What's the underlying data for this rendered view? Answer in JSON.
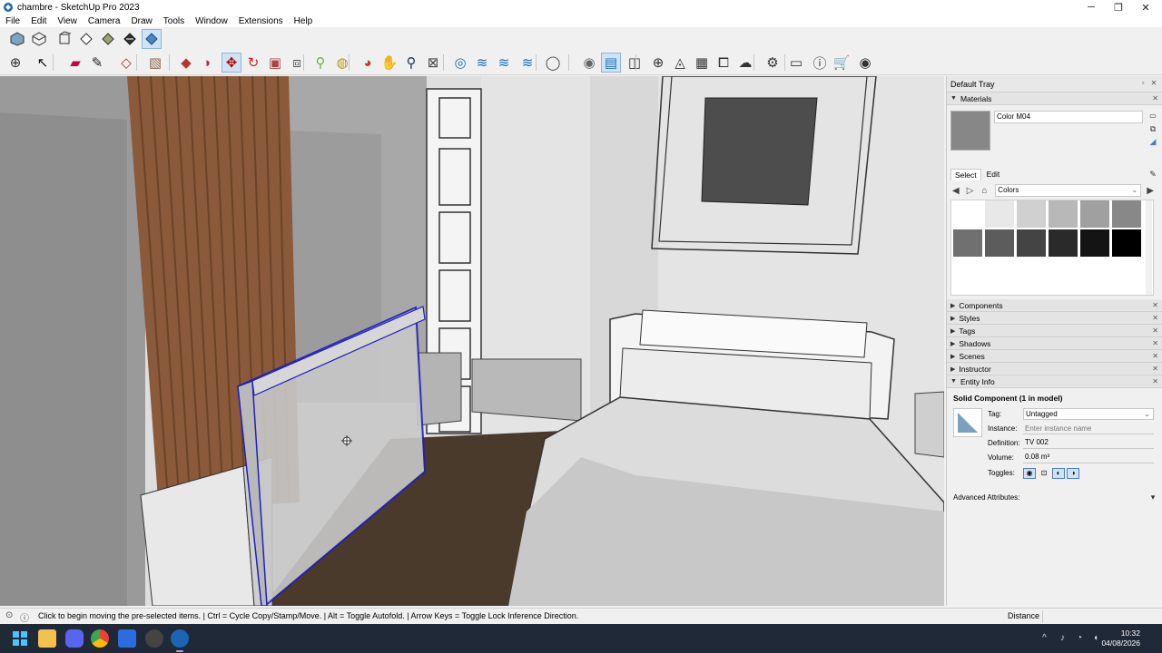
{
  "window": {
    "title": "chambre - SketchUp Pro 2023",
    "minimize": "─",
    "maximize": "❐",
    "close": "✕"
  },
  "menu": [
    "File",
    "Edit",
    "View",
    "Camera",
    "Draw",
    "Tools",
    "Window",
    "Extensions",
    "Help"
  ],
  "toolbar1": [
    {
      "name": "iso-view-icon",
      "active": false
    },
    {
      "name": "top-view-icon",
      "active": false
    },
    {
      "name": "front-view-icon",
      "active": false
    },
    {
      "name": "right-view-icon",
      "active": false
    },
    {
      "name": "back-view-icon",
      "active": false
    },
    {
      "name": "xray-style-icon",
      "active": false
    },
    {
      "name": "monochrome-style-icon",
      "active": true
    }
  ],
  "toolbar2_icons": [
    "zoom-extents-icon",
    "select-arrow-icon",
    "eraser-icon",
    "pencil-icon",
    "shapes-icon",
    "paint-bucket-icon",
    "push-pull-icon",
    "follow-me-icon",
    "move-icon",
    "rotate-icon",
    "scale-icon",
    "offset-icon",
    "tape-measure-icon",
    "paint-icon",
    "orbit-icon",
    "pan-icon",
    "zoom-icon",
    "zoom-window-icon",
    "section-plane-icon",
    "section-display-icon",
    "section-cut-icon",
    "section-fill-icon",
    "user-account-icon",
    "outer-shell-icon",
    "trim-icon",
    "split-icon",
    "add-location-icon",
    "shadow-icon",
    "texture-icon",
    "photo-icon",
    "cloud-icon",
    "settings-icon",
    "layout-icon",
    "info-icon",
    "cart-icon",
    "profile-icon"
  ],
  "tray": {
    "title": "Default Tray",
    "materials": {
      "header": "Materials",
      "name": "Color M04",
      "tabs": [
        "Select",
        "Edit"
      ],
      "library": "Colors",
      "swatches": [
        "#ffffff",
        "#e8e8e8",
        "#d0d0d0",
        "#b8b8b8",
        "#a0a0a0",
        "#888888",
        "#707070",
        "#5c5c5c",
        "#444444",
        "#2a2a2a",
        "#141414",
        "#000000"
      ]
    },
    "collapsed": [
      "Components",
      "Styles",
      "Tags",
      "Shadows",
      "Scenes",
      "Instructor"
    ],
    "entity": {
      "header": "Entity Info",
      "title": "Solid Component (1 in model)",
      "tag_label": "Tag:",
      "tag_value": "Untagged",
      "instance_label": "Instance:",
      "instance_placeholder": "Enter instance name",
      "definition_label": "Definition:",
      "definition_value": "TV 002",
      "volume_label": "Volume:",
      "volume_value": "0.08 m³",
      "toggles_label": "Toggles:",
      "advanced_label": "Advanced Attributes:"
    }
  },
  "status": {
    "text": "Click to begin moving the pre-selected items. | Ctrl = Cycle Copy/Stamp/Move. | Alt = Toggle Autofold. | Arrow Keys = Toggle Lock Inference Direction.",
    "measure_label": "Distance"
  },
  "taskbar": {
    "time": "10:32",
    "date": "04/08/2026"
  }
}
